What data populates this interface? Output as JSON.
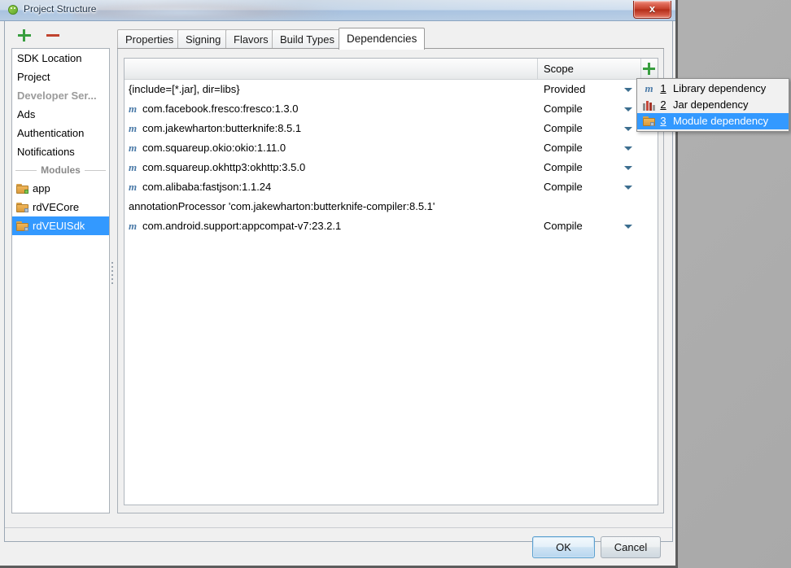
{
  "window": {
    "title": "Project Structure",
    "app_icon": "android-studio-icon",
    "close_label": "x"
  },
  "sidebar": {
    "toolbar": {
      "add_label": "+",
      "remove_label": "−"
    },
    "items": [
      {
        "label": "SDK Location",
        "type": "nav",
        "selected": false
      },
      {
        "label": "Project",
        "type": "nav",
        "selected": false
      },
      {
        "label": "Developer Ser...",
        "type": "nav-disabled",
        "selected": false
      },
      {
        "label": "Ads",
        "type": "nav",
        "selected": false
      },
      {
        "label": "Authentication",
        "type": "nav",
        "selected": false
      },
      {
        "label": "Notifications",
        "type": "nav",
        "selected": false
      }
    ],
    "modules_separator": "Modules",
    "modules": [
      {
        "label": "app",
        "icon": "module-app-icon",
        "selected": false
      },
      {
        "label": "rdVECore",
        "icon": "module-library-icon",
        "selected": false
      },
      {
        "label": "rdVEUISdk",
        "icon": "module-library-icon",
        "selected": true
      }
    ]
  },
  "tabs": [
    {
      "label": "Properties",
      "active": false
    },
    {
      "label": "Signing",
      "active": false
    },
    {
      "label": "Flavors",
      "active": false
    },
    {
      "label": "Build Types",
      "active": false
    },
    {
      "label": "Dependencies",
      "active": true
    }
  ],
  "table": {
    "headers": {
      "name": "",
      "scope": "Scope"
    },
    "add_button_label": "+",
    "rows": [
      {
        "icon": "",
        "name": "{include=[*.jar], dir=libs}",
        "scope": "Provided"
      },
      {
        "icon": "m",
        "name": "com.facebook.fresco:fresco:1.3.0",
        "scope": "Compile"
      },
      {
        "icon": "m",
        "name": "com.jakewharton:butterknife:8.5.1",
        "scope": "Compile"
      },
      {
        "icon": "m",
        "name": "com.squareup.okio:okio:1.11.0",
        "scope": "Compile"
      },
      {
        "icon": "m",
        "name": "com.squareup.okhttp3:okhttp:3.5.0",
        "scope": "Compile"
      },
      {
        "icon": "m",
        "name": "com.alibaba:fastjson:1.1.24",
        "scope": "Compile"
      },
      {
        "icon": "",
        "name": "annotationProcessor 'com.jakewharton:butterknife-compiler:8.5.1'",
        "scope": ""
      },
      {
        "icon": "m",
        "name": "com.android.support:appcompat-v7:23.2.1",
        "scope": "Compile"
      }
    ]
  },
  "popup_menu": {
    "items": [
      {
        "key": "1",
        "label": "Library dependency",
        "icon": "maven-m-icon",
        "highlighted": false
      },
      {
        "key": "2",
        "label": "Jar dependency",
        "icon": "books-jar-icon",
        "highlighted": false
      },
      {
        "key": "3",
        "label": "Module dependency",
        "icon": "folder-module-icon",
        "highlighted": true
      }
    ]
  },
  "buttons": {
    "ok": "OK",
    "cancel": "Cancel"
  },
  "colors": {
    "selection": "#3399ff",
    "add_green": "#389e3f",
    "remove_red": "#c0432f",
    "maven_blue": "#4a7aa8"
  }
}
